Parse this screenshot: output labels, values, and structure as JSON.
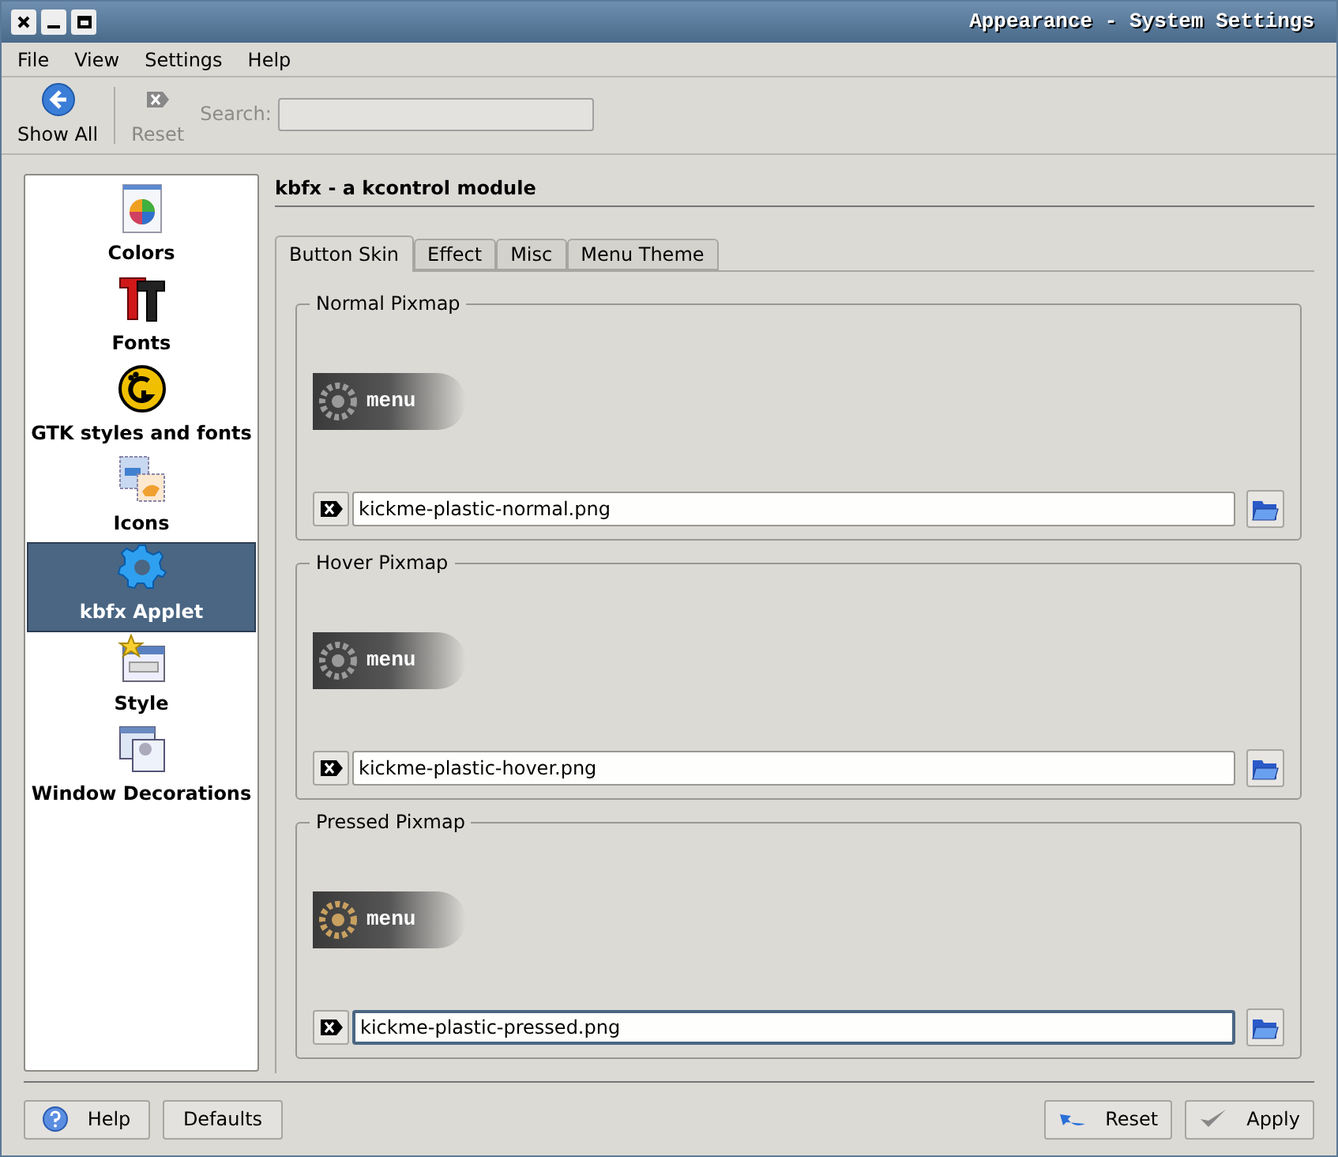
{
  "window": {
    "title": "Appearance - System Settings"
  },
  "menu_bar": [
    "File",
    "View",
    "Settings",
    "Help"
  ],
  "toolbar": {
    "items": [
      {
        "label": "Show All",
        "kind": "back",
        "disabled": false
      },
      {
        "label": "Reset",
        "kind": "reset",
        "disabled": true
      }
    ],
    "search": {
      "label": "Search:",
      "disabled": true
    }
  },
  "sidebar": {
    "items": [
      {
        "label": "Colors",
        "kind": "colors",
        "selected": false
      },
      {
        "label": "Fonts",
        "kind": "fonts",
        "selected": false
      },
      {
        "label": "GTK styles and fonts",
        "kind": "gtk",
        "selected": false
      },
      {
        "label": "Icons",
        "kind": "icons",
        "selected": false
      },
      {
        "label": "kbfx Applet",
        "kind": "gear",
        "selected": true
      },
      {
        "label": "Style",
        "kind": "style",
        "selected": false
      },
      {
        "label": "Window Decorations",
        "kind": "windeco",
        "selected": false
      }
    ]
  },
  "module": {
    "title": "kbfx - a kcontrol module",
    "tabs": [
      {
        "label": "Button Skin",
        "selected": true
      },
      {
        "label": "Effect",
        "selected": false
      },
      {
        "label": "Misc",
        "selected": false
      },
      {
        "label": "Menu Theme",
        "selected": false
      }
    ],
    "groups": [
      {
        "title": "Normal Pixmap",
        "preview_text": "menu",
        "color": "#9a9a9a",
        "value": "kickme-plastic-normal.png",
        "focused": false
      },
      {
        "title": "Hover Pixmap",
        "preview_text": "menu",
        "color": "#9a9a9a",
        "value": "kickme-plastic-hover.png",
        "focused": false
      },
      {
        "title": "Pressed Pixmap",
        "preview_text": "menu",
        "color": "#c8a060",
        "value": "kickme-plastic-pressed.png",
        "focused": true
      }
    ]
  },
  "buttons_left": [
    {
      "label": "Help",
      "kind": "help"
    },
    {
      "label": "Defaults",
      "kind": "plain"
    }
  ],
  "buttons_right": [
    {
      "label": "Reset",
      "kind": "reset"
    },
    {
      "label": "Apply",
      "kind": "apply"
    }
  ]
}
